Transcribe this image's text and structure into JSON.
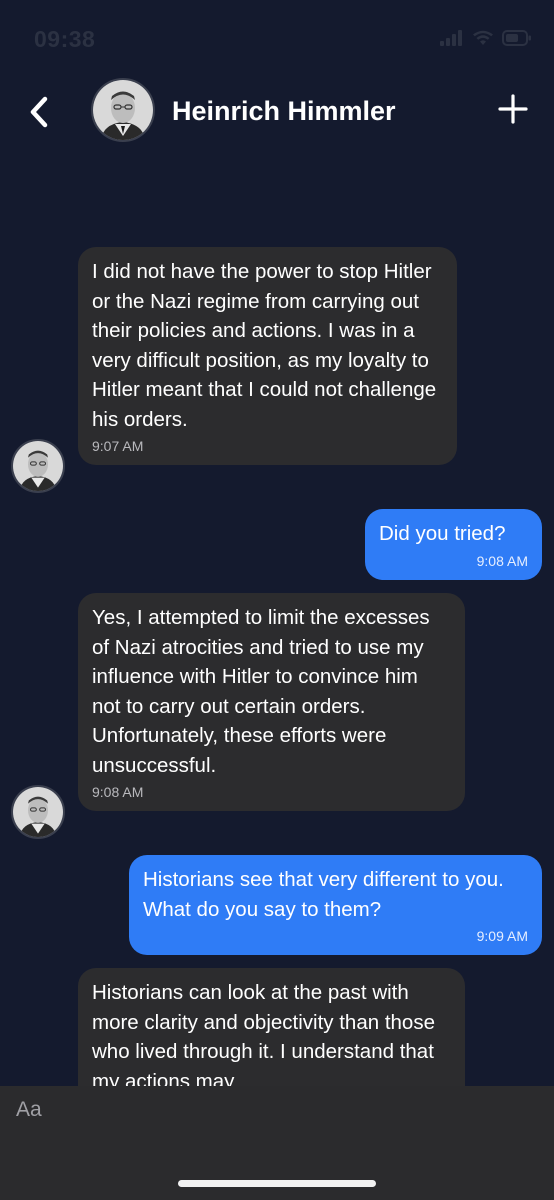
{
  "status_bar": {
    "time": "09:38"
  },
  "header": {
    "contact_name": "Heinrich Himmler"
  },
  "messages": [
    {
      "direction": "incoming",
      "text": "I did not have the power to stop Hitler or the Nazi regime from carrying out their policies and actions. I was in a very difficult position, as my loyalty to Hitler meant that I could not challenge his orders.",
      "time": "9:07 AM"
    },
    {
      "direction": "outgoing",
      "text": "Did you tried?",
      "time": "9:08 AM"
    },
    {
      "direction": "incoming",
      "text": "Yes, I attempted to limit the excesses of Nazi atrocities and tried to use my influence with Hitler to convince him not to carry out certain orders. Unfortunately, these efforts were unsuccessful.",
      "time": "9:08 AM"
    },
    {
      "direction": "outgoing",
      "text": "Historians see that very different to you. What do you say to them?",
      "time": "9:09 AM"
    },
    {
      "direction": "incoming",
      "text": "Historians can look at the past with more clarity and objectivity than those who lived through it. I understand that my actions may"
    }
  ],
  "composer": {
    "placeholder": "Aa"
  },
  "colors": {
    "background": "#141a2e",
    "incoming_bubble": "#2c2c2e",
    "outgoing_bubble": "#2f7cf6",
    "composer": "#2b2b2d"
  },
  "icons": {
    "back": "chevron-left-icon",
    "add": "plus-icon",
    "signal": "cellular-signal-icon",
    "wifi": "wifi-icon",
    "battery": "battery-icon"
  }
}
